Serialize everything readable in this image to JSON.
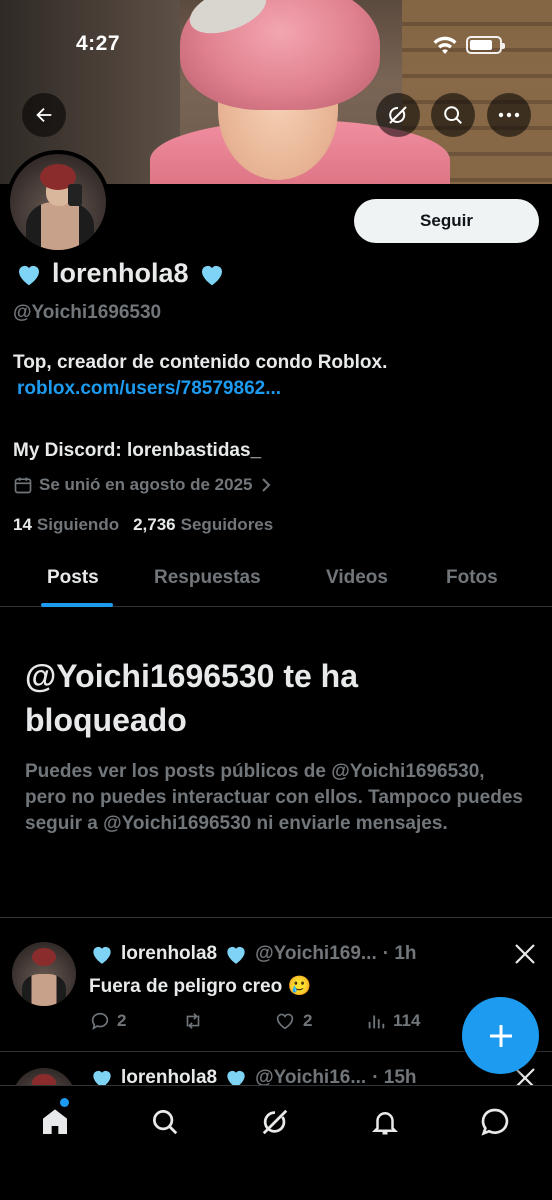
{
  "status_bar": {
    "time": "4:27"
  },
  "profile": {
    "display_name": "lorenhola8",
    "name_emoji": "🩵",
    "handle": "@Yoichi1696530",
    "bio_line1": "Top, creador de contenido condo Roblox.",
    "bio_link": "roblox.com/users/78579862...",
    "bio_line2": "My Discord: lorenbastidas_",
    "joined": "Se unió en agosto de 2025",
    "following_count": "14",
    "following_label": "Siguiendo",
    "followers_count": "2,736",
    "followers_label": "Seguidores",
    "follow_button": "Seguir"
  },
  "tabs": [
    "Posts",
    "Respuestas",
    "Videos",
    "Fotos"
  ],
  "active_tab": "Posts",
  "blocked_notice": {
    "title": "@Yoichi1696530 te ha bloqueado",
    "description": "Puedes ver los posts públicos de @Yoichi1696530, pero no puedes interactuar con ellos. Tampoco puedes seguir a @Yoichi1696530 ni enviarle mensajes."
  },
  "posts": [
    {
      "name": "lorenhola8",
      "handle": "@Yoichi169...",
      "time": "· 1h",
      "text": "Fuera de peligro creo 🥲",
      "replies": "2",
      "reposts": "",
      "likes": "2",
      "views": "114"
    },
    {
      "name": "lorenhola8",
      "handle": "@Yoichi16...",
      "time": "· 15h"
    }
  ],
  "colors": {
    "accent": "#1d9bf0",
    "background": "#000000",
    "text_primary": "#e7e9ea",
    "text_secondary": "#71767b",
    "heart_emoji": "#7fd3f5"
  },
  "icons": {
    "back": "arrow-left-icon",
    "grok": "grok-icon",
    "search": "search-icon",
    "more": "more-icon",
    "calendar": "calendar-icon",
    "x_logo": "x-logo-icon",
    "compose": "plus-icon",
    "nav": [
      "home-icon",
      "search-icon",
      "grok-icon",
      "bell-icon",
      "messages-icon"
    ]
  }
}
